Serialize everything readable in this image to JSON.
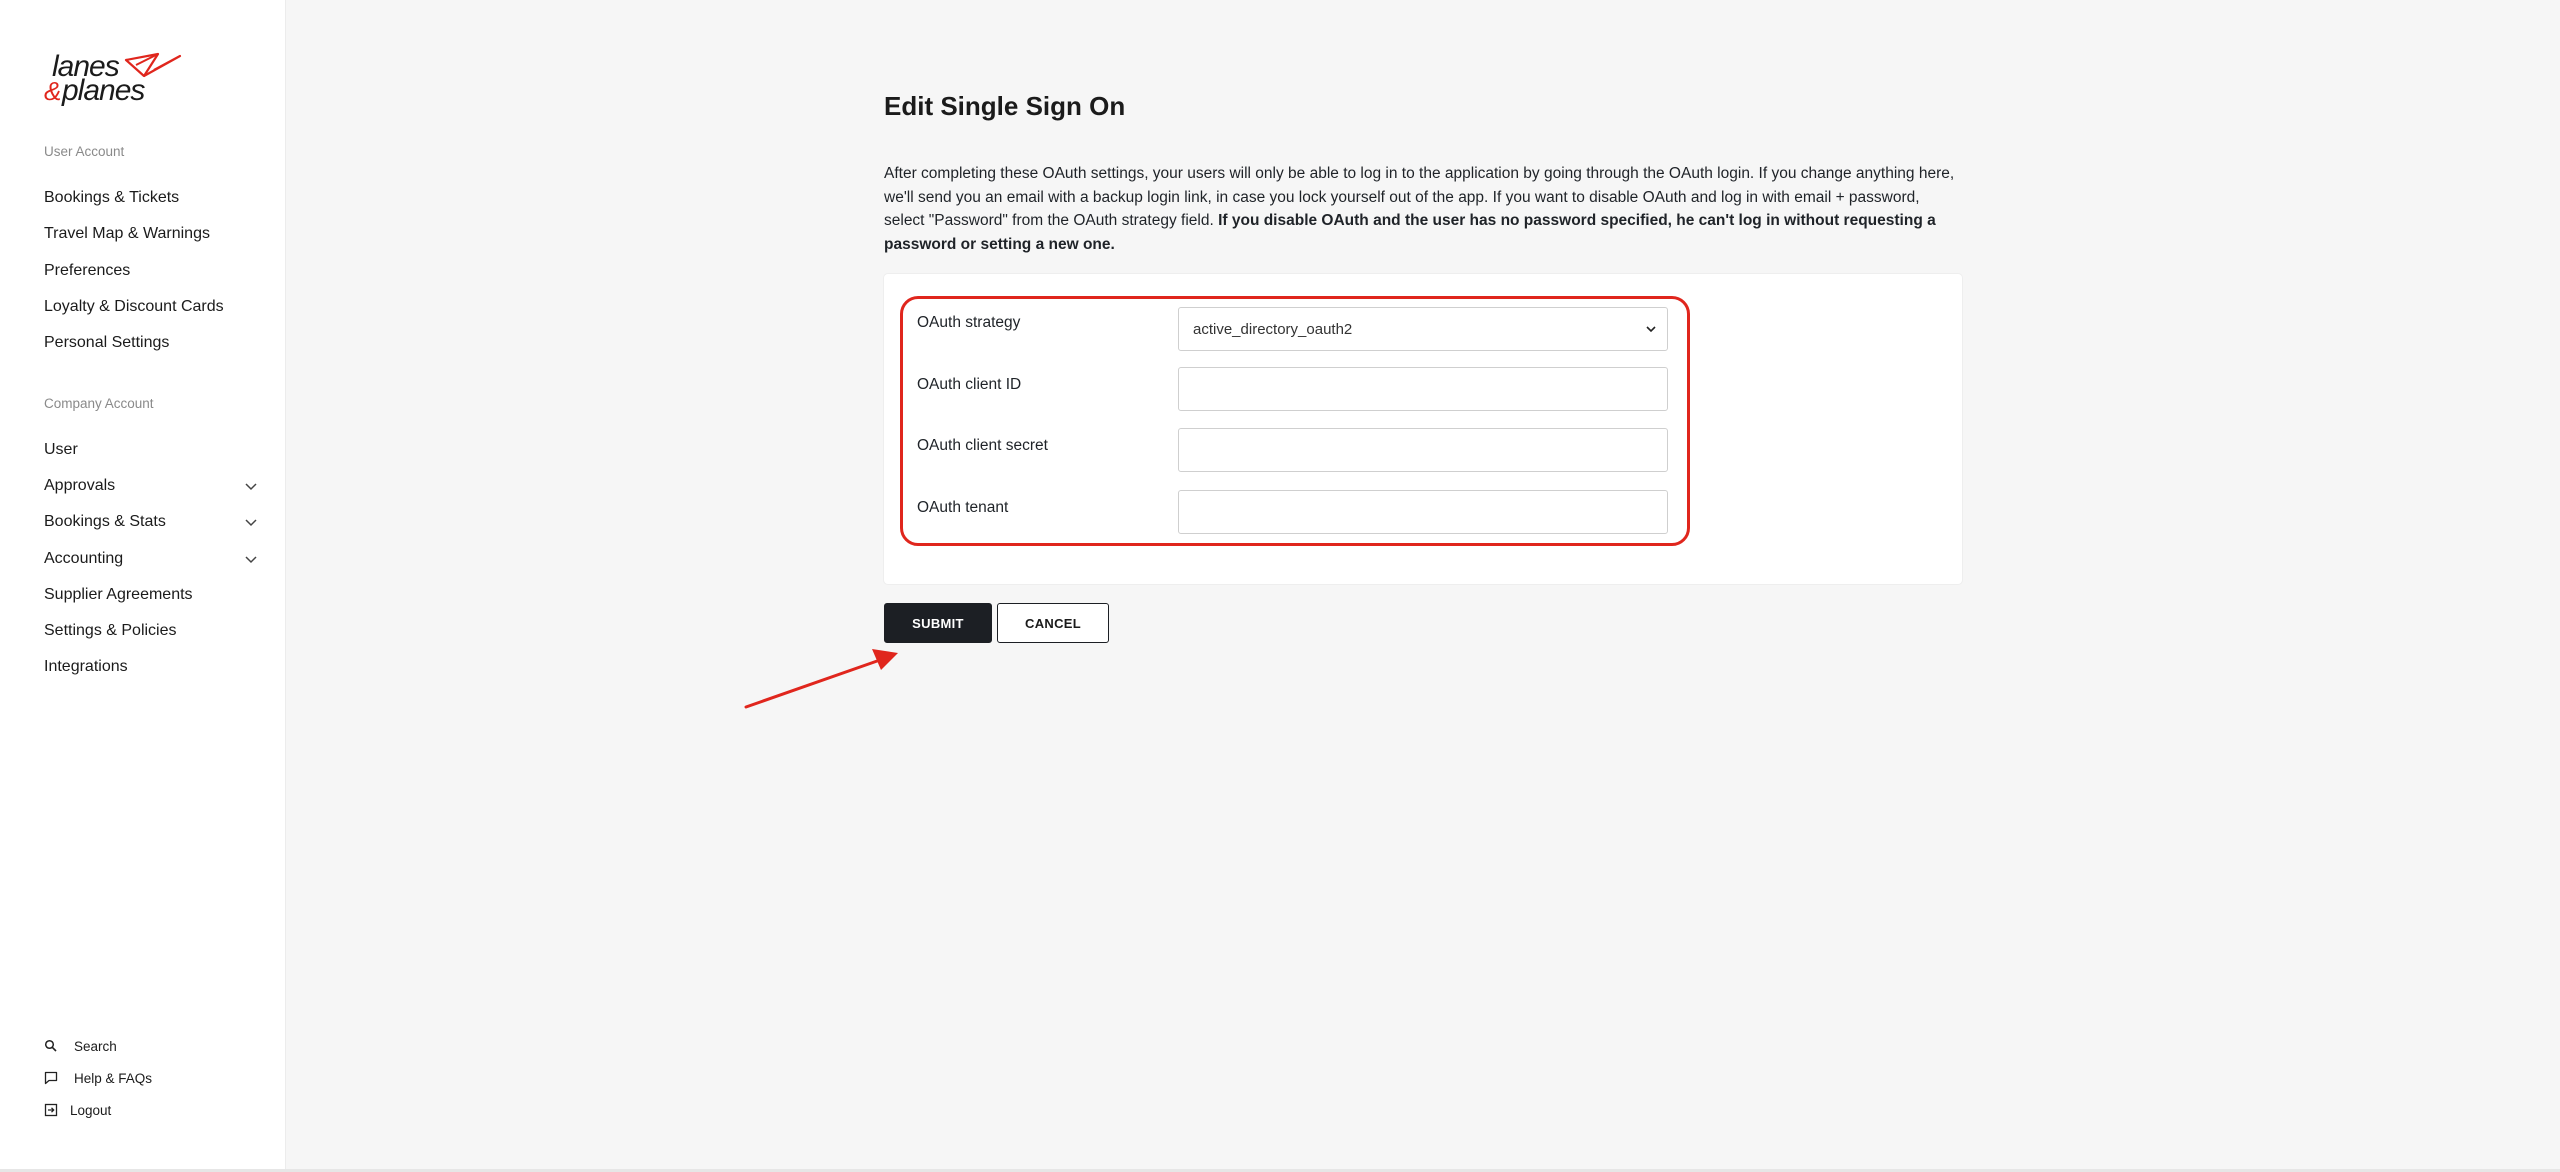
{
  "brand": {
    "line1": "lanes",
    "amp": "&",
    "line2": "planes",
    "accent_color": "#e0261d"
  },
  "sidebar": {
    "user_section_label": "User Account",
    "user_items": [
      {
        "label": "Bookings & Tickets"
      },
      {
        "label": "Travel Map & Warnings"
      },
      {
        "label": "Preferences"
      },
      {
        "label": "Loyalty & Discount Cards"
      },
      {
        "label": "Personal Settings"
      }
    ],
    "company_section_label": "Company Account",
    "company_items": [
      {
        "label": "User",
        "expandable": false
      },
      {
        "label": "Approvals",
        "expandable": true,
        "icon": "chevron-down-icon"
      },
      {
        "label": "Bookings & Stats",
        "expandable": true,
        "icon": "chevron-down-icon"
      },
      {
        "label": "Accounting",
        "expandable": true,
        "icon": "chevron-down-icon"
      },
      {
        "label": "Supplier Agreements",
        "expandable": false
      },
      {
        "label": "Settings & Policies",
        "expandable": false
      },
      {
        "label": "Integrations",
        "expandable": false
      }
    ],
    "footer": {
      "search": {
        "label": "Search",
        "icon": "search-icon"
      },
      "help": {
        "label": "Help & FAQs",
        "icon": "chat-icon"
      },
      "logout": {
        "label": "Logout",
        "icon": "logout-icon"
      }
    }
  },
  "main": {
    "title": "Edit Single Sign On",
    "description": "After completing these OAuth settings, your users will only be able to log in to the application by going through the OAuth login. If you change anything here, we'll send you an email with a backup login link, in case you lock yourself out of the app. If you want to disable OAuth and log in with email + password, select \"Password\" from the OAuth strategy field.",
    "description_bold": "If you disable OAuth and the user has no password specified, he can't log in without requesting a password or setting a new one.",
    "form": {
      "strategy": {
        "label": "OAuth strategy",
        "value": "active_directory_oauth2"
      },
      "client_id": {
        "label": "OAuth client ID",
        "value": ""
      },
      "client_secret": {
        "label": "OAuth client secret",
        "value": ""
      },
      "tenant": {
        "label": "OAuth tenant",
        "value": ""
      }
    },
    "buttons": {
      "submit": "SUBMIT",
      "cancel": "CANCEL"
    }
  },
  "colors": {
    "annotation": "#e0261d",
    "primary_button": "#1c1f24",
    "page_background": "#f6f6f6"
  }
}
